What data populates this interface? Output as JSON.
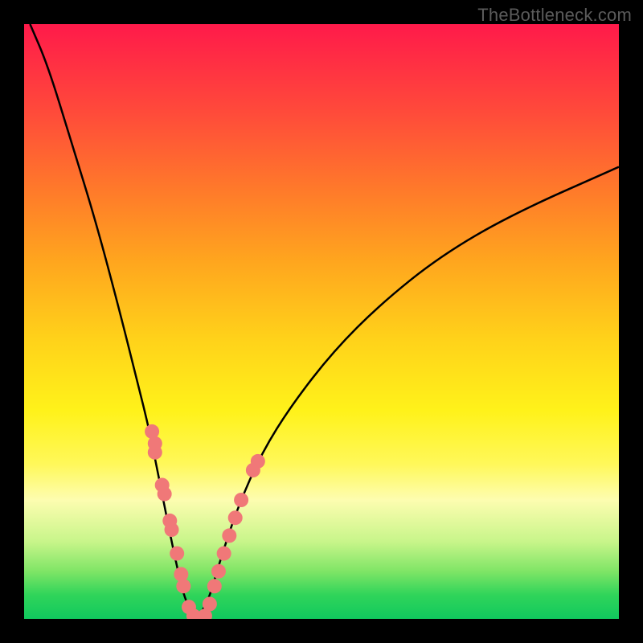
{
  "watermark": "TheBottleneck.com",
  "chart_data": {
    "type": "line",
    "title": "",
    "xlabel": "",
    "ylabel": "",
    "xlim": [
      0,
      100
    ],
    "ylim": [
      0,
      100
    ],
    "curve": {
      "left_branch": [
        {
          "x": 1,
          "y": 100
        },
        {
          "x": 4,
          "y": 93
        },
        {
          "x": 8,
          "y": 80
        },
        {
          "x": 12,
          "y": 67
        },
        {
          "x": 16,
          "y": 52
        },
        {
          "x": 19,
          "y": 40
        },
        {
          "x": 21,
          "y": 32
        },
        {
          "x": 23,
          "y": 22
        },
        {
          "x": 25,
          "y": 12
        },
        {
          "x": 27,
          "y": 3
        },
        {
          "x": 29,
          "y": 0
        }
      ],
      "right_branch": [
        {
          "x": 29,
          "y": 0
        },
        {
          "x": 31,
          "y": 3
        },
        {
          "x": 33,
          "y": 10
        },
        {
          "x": 36,
          "y": 19
        },
        {
          "x": 40,
          "y": 28
        },
        {
          "x": 45,
          "y": 36
        },
        {
          "x": 52,
          "y": 45
        },
        {
          "x": 60,
          "y": 53
        },
        {
          "x": 70,
          "y": 61
        },
        {
          "x": 82,
          "y": 68
        },
        {
          "x": 100,
          "y": 76
        }
      ]
    },
    "points_left": [
      {
        "x": 21.5,
        "y": 31.5
      },
      {
        "x": 22.0,
        "y": 29.5
      },
      {
        "x": 22.0,
        "y": 28.0
      },
      {
        "x": 23.2,
        "y": 22.5
      },
      {
        "x": 23.6,
        "y": 21.0
      },
      {
        "x": 24.5,
        "y": 16.5
      },
      {
        "x": 24.8,
        "y": 15.0
      },
      {
        "x": 25.7,
        "y": 11.0
      },
      {
        "x": 26.4,
        "y": 7.5
      },
      {
        "x": 26.8,
        "y": 5.5
      },
      {
        "x": 27.7,
        "y": 2.0
      },
      {
        "x": 28.5,
        "y": 0.5
      },
      {
        "x": 29.5,
        "y": 0.0
      }
    ],
    "points_right": [
      {
        "x": 30.4,
        "y": 0.5
      },
      {
        "x": 31.2,
        "y": 2.5
      },
      {
        "x": 32.0,
        "y": 5.5
      },
      {
        "x": 32.7,
        "y": 8.0
      },
      {
        "x": 33.6,
        "y": 11.0
      },
      {
        "x": 34.5,
        "y": 14.0
      },
      {
        "x": 35.5,
        "y": 17.0
      },
      {
        "x": 36.5,
        "y": 20.0
      },
      {
        "x": 38.5,
        "y": 25.0
      },
      {
        "x": 39.3,
        "y": 26.5
      }
    ],
    "point_color": "#f07878",
    "point_radius_px": 9
  }
}
